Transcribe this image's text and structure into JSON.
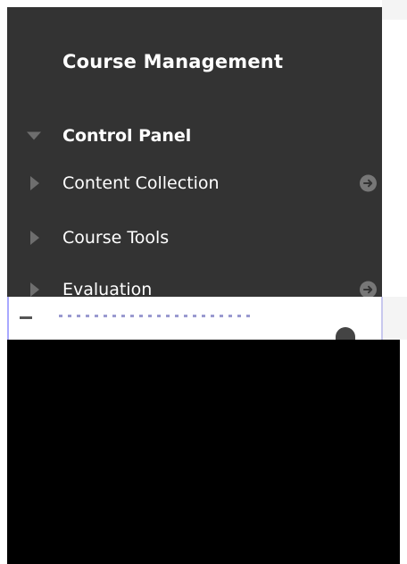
{
  "panel": {
    "heading": "Course Management",
    "items": [
      {
        "label": "Control Panel",
        "expanded": true,
        "bold": true,
        "icon": "triangle-down-icon",
        "has_go_icon": false
      },
      {
        "label": "Content Collection",
        "expanded": false,
        "bold": false,
        "icon": "triangle-right-icon",
        "has_go_icon": true
      },
      {
        "label": "Course Tools",
        "expanded": false,
        "bold": false,
        "icon": "triangle-right-icon",
        "has_go_icon": false
      },
      {
        "label": "Evaluation",
        "expanded": false,
        "bold": false,
        "icon": "triangle-right-icon",
        "has_go_icon": true
      }
    ],
    "go_icon": "arrow-circle-right-icon"
  },
  "colors": {
    "panel_bg": "#333333",
    "text": "#ffffff",
    "triangle": "#6e6e6e",
    "go_icon_bg": "#777777",
    "redaction": "#000000"
  }
}
